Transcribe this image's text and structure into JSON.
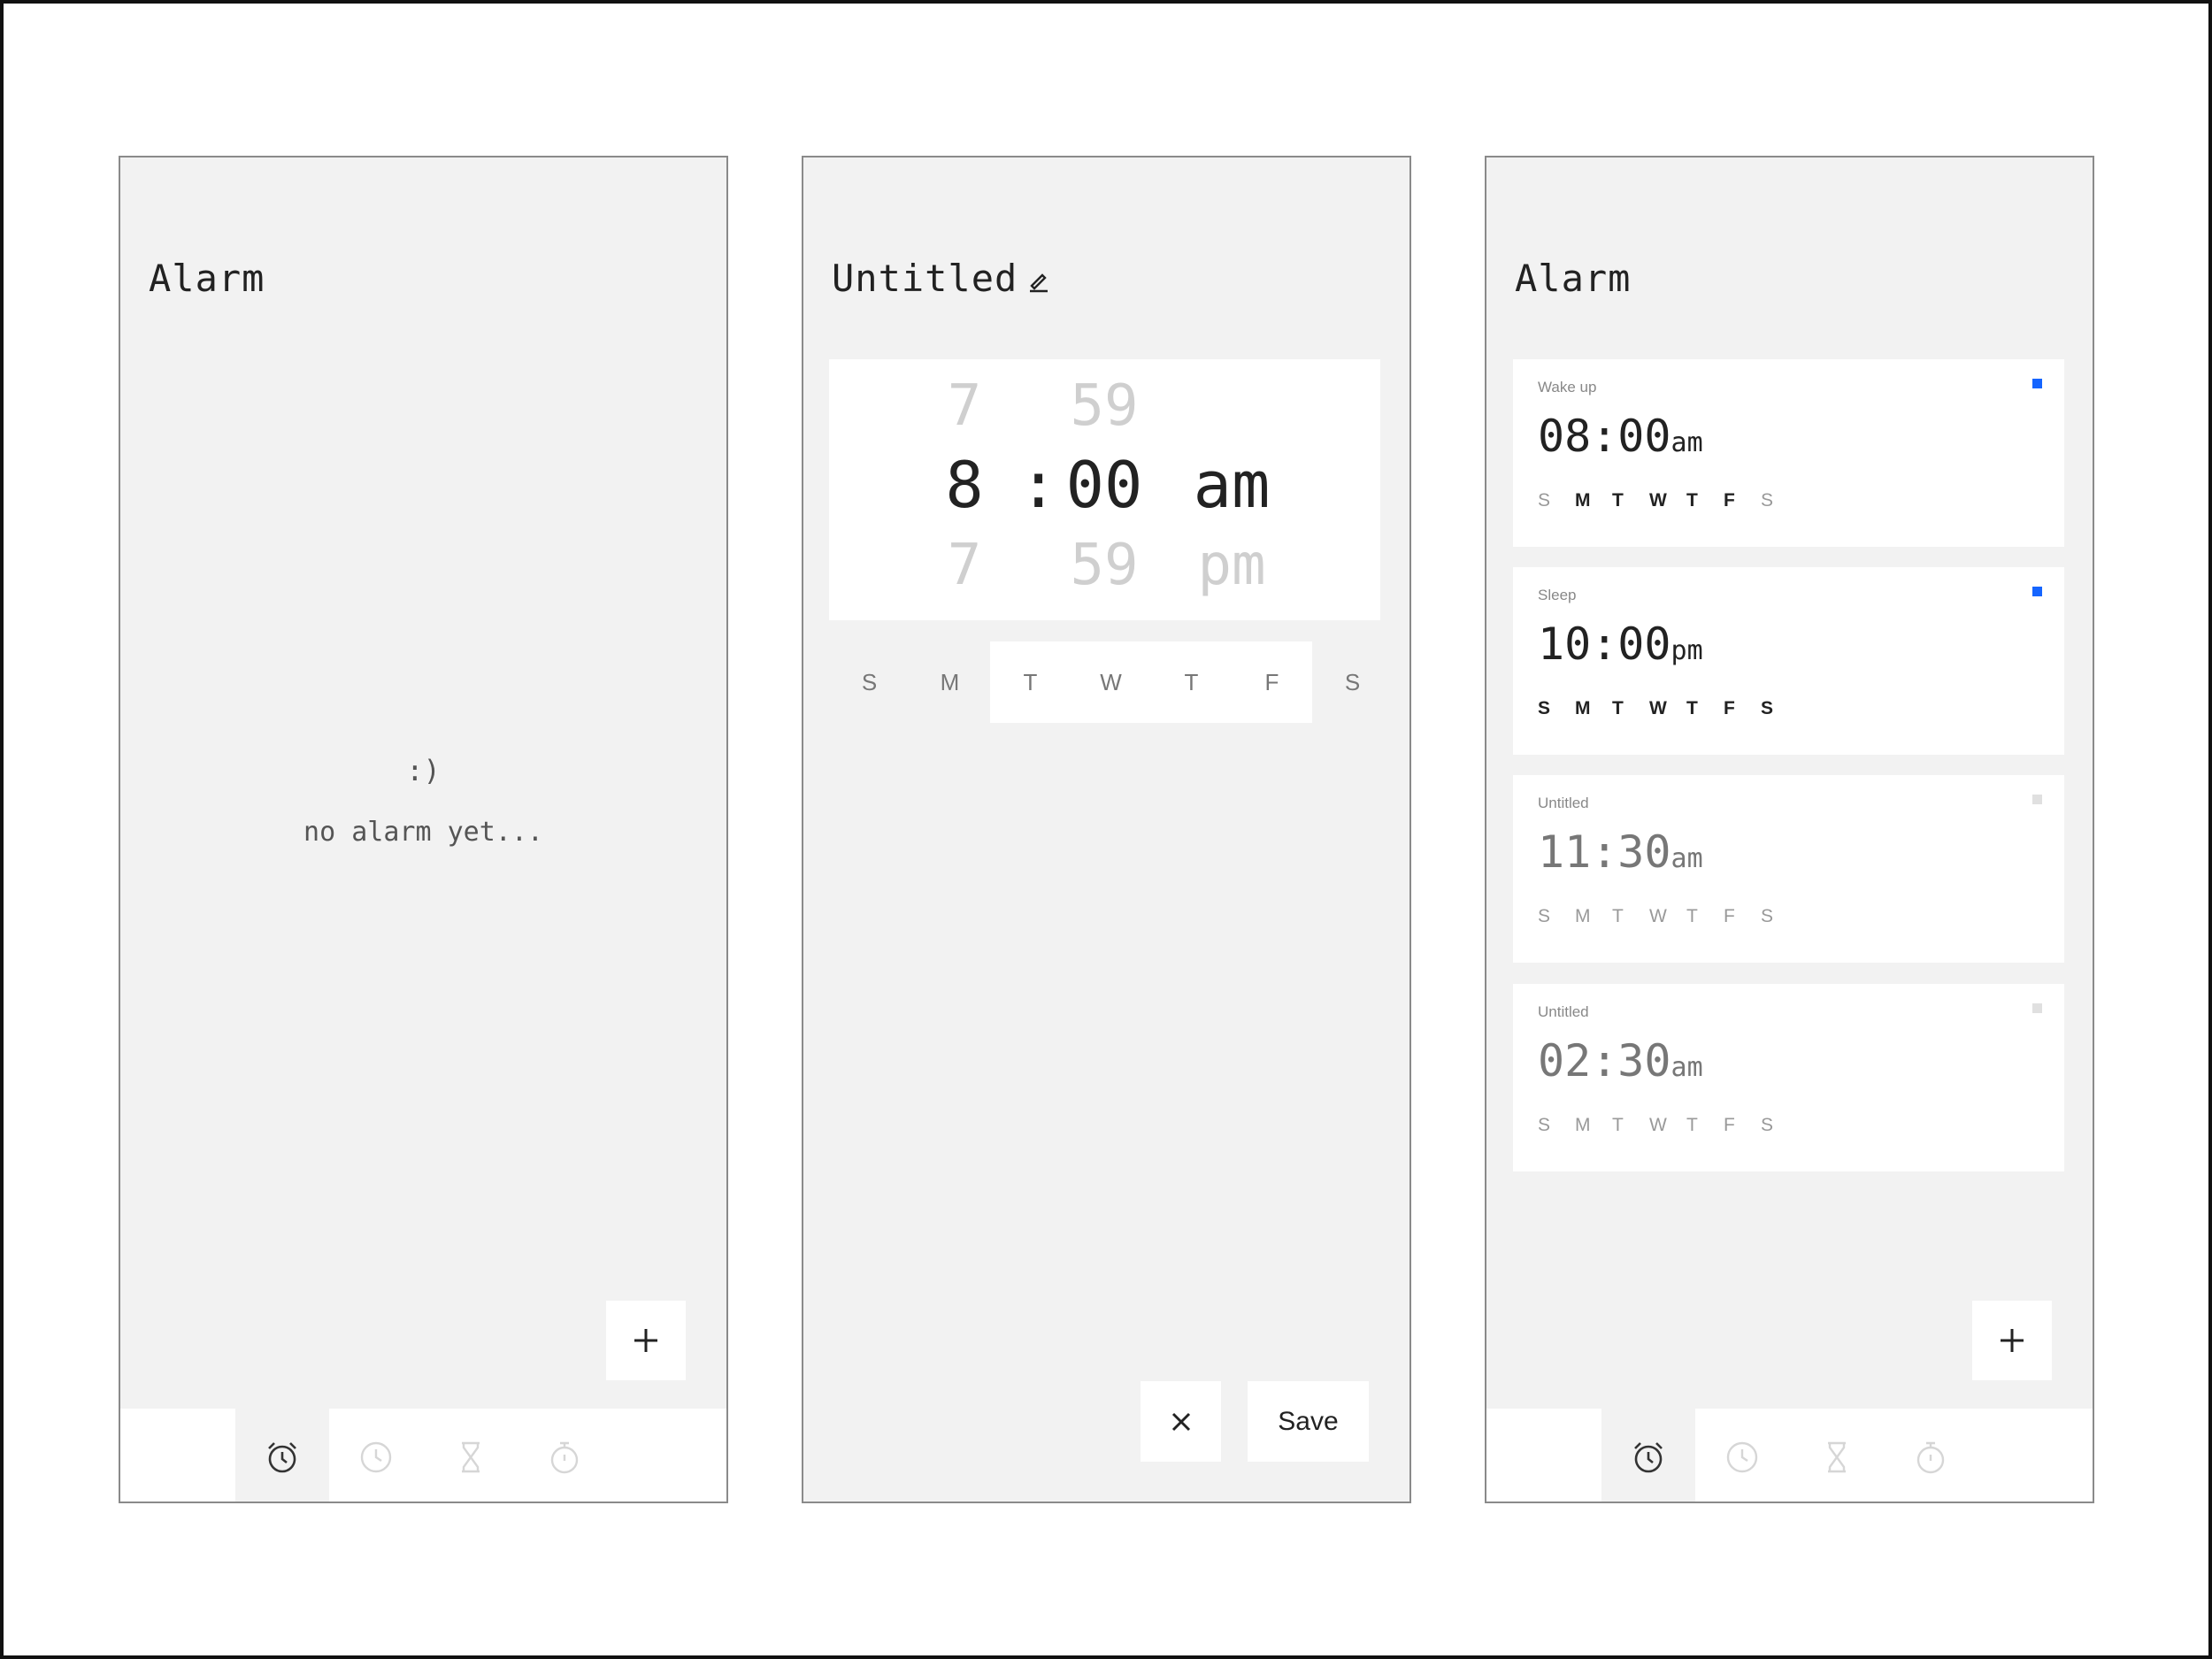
{
  "colors": {
    "screen_bg": "#f2f2f2",
    "surface": "#ffffff",
    "accent": "#1565ff",
    "text": "#222222",
    "muted": "#cfcfcf"
  },
  "screen1": {
    "title": "Alarm",
    "empty_face": ":)",
    "empty_text": "no alarm yet...",
    "add_button_icon": "plus-icon",
    "tabs": [
      {
        "icon": "alarm-clock-icon",
        "active": true
      },
      {
        "icon": "clock-icon",
        "active": false
      },
      {
        "icon": "hourglass-icon",
        "active": false
      },
      {
        "icon": "stopwatch-icon",
        "active": false
      }
    ]
  },
  "screen2": {
    "title": "Untitled",
    "edit_icon": "pencil-icon",
    "picker": {
      "hour_above": "7",
      "minute_above": "59",
      "hour": "8",
      "separator": ":",
      "minute": "00",
      "period": "am",
      "hour_below": "7",
      "minute_below": "59",
      "period_below": "pm"
    },
    "days": [
      {
        "label": "S",
        "on": false
      },
      {
        "label": "M",
        "on": false
      },
      {
        "label": "T",
        "on": true
      },
      {
        "label": "W",
        "on": true
      },
      {
        "label": "T",
        "on": true
      },
      {
        "label": "F",
        "on": true
      },
      {
        "label": "S",
        "on": false
      }
    ],
    "cancel_icon": "close-icon",
    "save_label": "Save"
  },
  "screen3": {
    "title": "Alarm",
    "alarms": [
      {
        "label": "Wake up",
        "time": "08:00",
        "period": "am",
        "enabled": true,
        "days": [
          {
            "label": "S",
            "on": false
          },
          {
            "label": "M",
            "on": true
          },
          {
            "label": "T",
            "on": true
          },
          {
            "label": "W",
            "on": true
          },
          {
            "label": "T",
            "on": true
          },
          {
            "label": "F",
            "on": true
          },
          {
            "label": "S",
            "on": false
          }
        ]
      },
      {
        "label": "Sleep",
        "time": "10:00",
        "period": "pm",
        "enabled": true,
        "days": [
          {
            "label": "S",
            "on": true
          },
          {
            "label": "M",
            "on": true
          },
          {
            "label": "T",
            "on": true
          },
          {
            "label": "W",
            "on": true
          },
          {
            "label": "T",
            "on": true
          },
          {
            "label": "F",
            "on": true
          },
          {
            "label": "S",
            "on": true
          }
        ]
      },
      {
        "label": "Untitled",
        "time": "11:30",
        "period": "am",
        "enabled": false,
        "days": [
          {
            "label": "S",
            "on": false
          },
          {
            "label": "M",
            "on": false
          },
          {
            "label": "T",
            "on": false
          },
          {
            "label": "W",
            "on": false
          },
          {
            "label": "T",
            "on": false
          },
          {
            "label": "F",
            "on": false
          },
          {
            "label": "S",
            "on": false
          }
        ]
      },
      {
        "label": "Untitled",
        "time": "02:30",
        "period": "am",
        "enabled": false,
        "days": [
          {
            "label": "S",
            "on": false
          },
          {
            "label": "M",
            "on": false
          },
          {
            "label": "T",
            "on": false
          },
          {
            "label": "W",
            "on": false
          },
          {
            "label": "T",
            "on": false
          },
          {
            "label": "F",
            "on": false
          },
          {
            "label": "S",
            "on": false
          }
        ]
      }
    ],
    "add_button_icon": "plus-icon",
    "tabs": [
      {
        "icon": "alarm-clock-icon",
        "active": true
      },
      {
        "icon": "clock-icon",
        "active": false
      },
      {
        "icon": "hourglass-icon",
        "active": false
      },
      {
        "icon": "stopwatch-icon",
        "active": false
      }
    ]
  }
}
